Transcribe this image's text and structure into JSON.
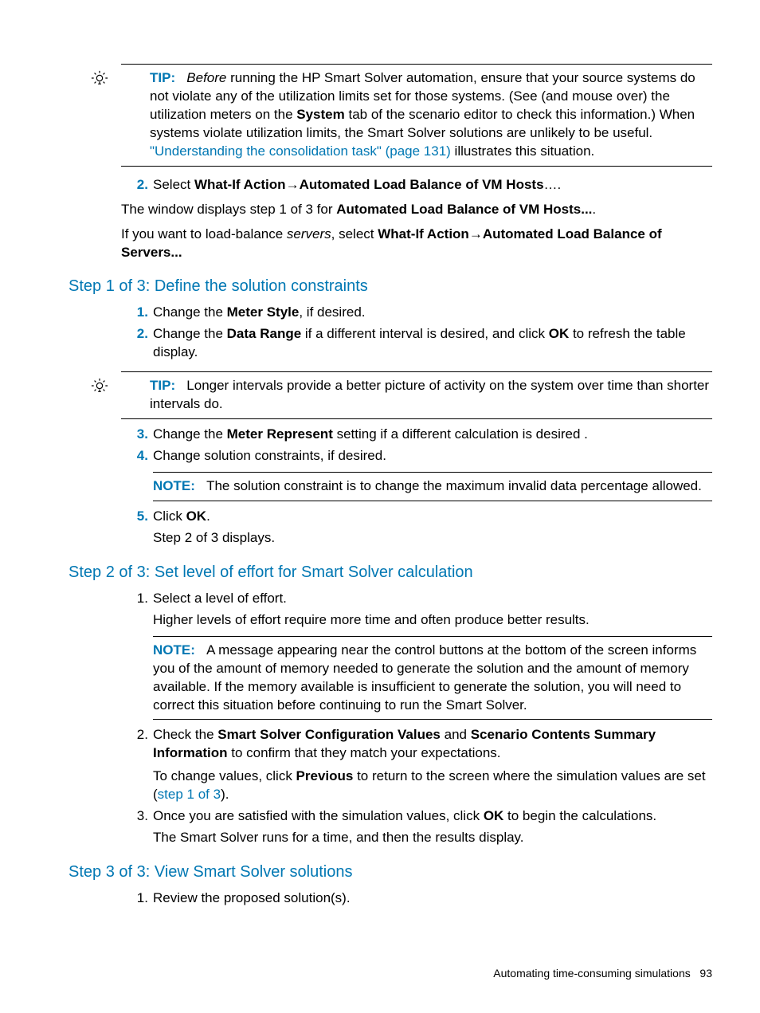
{
  "tip1": {
    "label": "TIP:",
    "before_italic": "Before",
    "t1": " running the HP Smart Solver automation, ensure that your source systems do not violate any of the utilization limits set for those systems. (See (and mouse over) the utilization meters on the ",
    "b1": "System",
    "t2": " tab of the scenario editor to check this information.) When systems violate utilization limits, the Smart Solver solutions are unlikely to be useful. ",
    "link": "\"Understanding the consolidation task\" (page 131)",
    "t3": " illustrates this situation."
  },
  "step_select": {
    "t1": "Select ",
    "b1": "What-If Action",
    "arrow1": "→",
    "b2": "Automated Load Balance of VM Hosts",
    "t2": "…."
  },
  "after_select": {
    "line1_a": "The window displays step 1 of 3 for ",
    "line1_b": "Automated Load Balance of VM Hosts...",
    "line1_c": ".",
    "line2_a": "If you want to load-balance ",
    "line2_b": "servers",
    "line2_c": ", select ",
    "line2_d": "What-If Action",
    "arrow": "→",
    "line2_e": "Automated Load Balance of Servers..."
  },
  "h1": "Step 1 of 3: Define the solution constraints",
  "s1_li1": {
    "a": "Change the ",
    "b": "Meter Style",
    "c": ", if desired."
  },
  "s1_li2": {
    "a": "Change the ",
    "b": "Data Range",
    "c": " if a different interval is desired, and click ",
    "d": "OK",
    "e": " to refresh the table display."
  },
  "tip2": {
    "label": "TIP:",
    "text": "Longer intervals provide a better picture of activity on the system over time than shorter intervals do."
  },
  "s1_li3": {
    "a": "Change the ",
    "b": "Meter Represent",
    "c": " setting if a different calculation is desired ."
  },
  "s1_li4": "Change solution constraints, if desired.",
  "note1": {
    "label": "NOTE:",
    "text": "The solution constraint is to change the maximum invalid data percentage allowed."
  },
  "s1_li5": {
    "a": "Click ",
    "b": "OK",
    "c": ".",
    "d": "Step 2 of 3 displays."
  },
  "h2": "Step 2 of 3: Set level of effort for Smart Solver calculation",
  "s2_li1": {
    "a": "Select a level of effort.",
    "b": "Higher levels of effort require more time and often produce better results."
  },
  "note2": {
    "label": "NOTE:",
    "text": "A message appearing near the control buttons at the bottom of the screen informs you of the amount of memory needed to generate the solution and the amount of memory available. If the memory available is insufficient to generate the solution, you will need to correct this situation before continuing to run the Smart Solver."
  },
  "s2_li2": {
    "a": "Check the ",
    "b": "Smart Solver Configuration Values",
    "c": " and ",
    "d": "Scenario Contents Summary Information",
    "e": " to confirm that they match your expectations.",
    "f": "To change values, click ",
    "g": "Previous",
    "h": " to return to the screen where the simulation values are set (",
    "link": "step 1 of 3",
    "i": ")."
  },
  "s2_li3": {
    "a": "Once you are satisfied with the simulation values, click ",
    "b": "OK",
    "c": " to begin the calculations.",
    "d": "The Smart Solver runs for a time, and then the results display."
  },
  "h3": "Step 3 of 3: View Smart Solver solutions",
  "s3_li1": "Review the proposed solution(s).",
  "footer": {
    "text": "Automating time-consuming simulations",
    "page": "93"
  }
}
